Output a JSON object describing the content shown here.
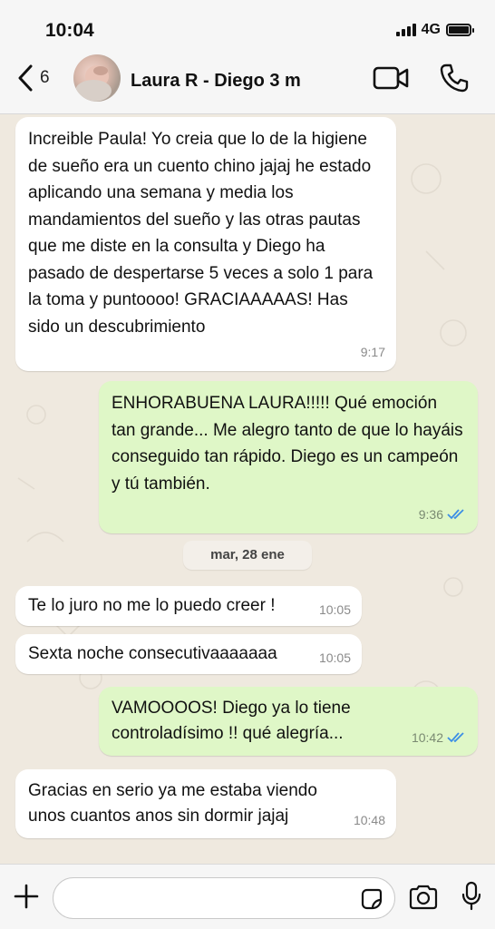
{
  "status": {
    "time": "10:04",
    "network": "4G"
  },
  "header": {
    "back_count": "6",
    "contact_name": "Laura R - Diego 3 m"
  },
  "date_divider": "mar, 28 ene",
  "messages": [
    {
      "dir": "in",
      "text": "Increible Paula! Yo creia que lo de la higiene de sueño era un cuento chino jajaj he estado aplicando una semana y media los mandamientos del sueño y las otras pautas que me diste en la consulta y Diego ha pasado de despertarse 5 veces a solo 1 para la toma y puntoooo! GRACIAAAAAS! Has sido un descubrimiento",
      "time": "9:17"
    },
    {
      "dir": "out",
      "text": "ENHORABUENA LAURA!!!!! Qué emoción tan grande... Me alegro tanto de que lo hayáis conseguido tan rápido. Diego es un campeón y tú también.",
      "time": "9:36"
    },
    {
      "dir": "in",
      "text": "Te lo juro no me lo puedo creer !",
      "time": "10:05"
    },
    {
      "dir": "in",
      "text": "Sexta noche consecutivaaaaaaa",
      "time": "10:05"
    },
    {
      "dir": "out",
      "text": "VAMOOOOS! Diego ya lo tiene controladísimo !! qué alegría...",
      "time": "10:42"
    },
    {
      "dir": "in",
      "text": "Gracias en serio ya me estaba viendo unos cuantos anos sin dormir jajaj",
      "time": "10:48"
    }
  ],
  "colors": {
    "outgoing_bubble": "#dff7c7",
    "incoming_bubble": "#ffffff",
    "read_ticks": "#3b8ee6"
  },
  "icons": [
    "back-chevron-icon",
    "video-call-icon",
    "phone-icon",
    "plus-icon",
    "sticker-icon",
    "camera-icon",
    "microphone-icon",
    "double-check-icon"
  ]
}
